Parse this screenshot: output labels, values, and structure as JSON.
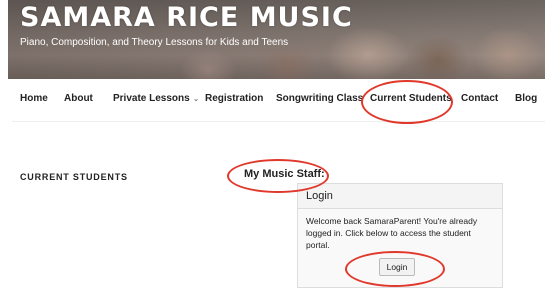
{
  "header": {
    "site_title": "SAMARA RICE MUSIC",
    "tagline": "Piano, Composition, and Theory Lessons for Kids and Teens"
  },
  "nav": {
    "items": [
      {
        "label": "Home"
      },
      {
        "label": "About"
      },
      {
        "label": "Private Lessons",
        "has_dropdown": true
      },
      {
        "label": "Registration"
      },
      {
        "label": "Songwriting Class"
      },
      {
        "label": "Current Students"
      },
      {
        "label": "Contact"
      },
      {
        "label": "Blog"
      }
    ],
    "dropdown_icon": "chevron-down-icon"
  },
  "page": {
    "heading": "CURRENT STUDENTS",
    "staff_title": "My Music Staff:"
  },
  "login_widget": {
    "title": "Login",
    "message": "Welcome back SamaraParent! You're already logged in. Click below to access the student portal.",
    "button_label": "Login"
  },
  "colors": {
    "annotation": "#e0392c",
    "text": "#222222"
  }
}
